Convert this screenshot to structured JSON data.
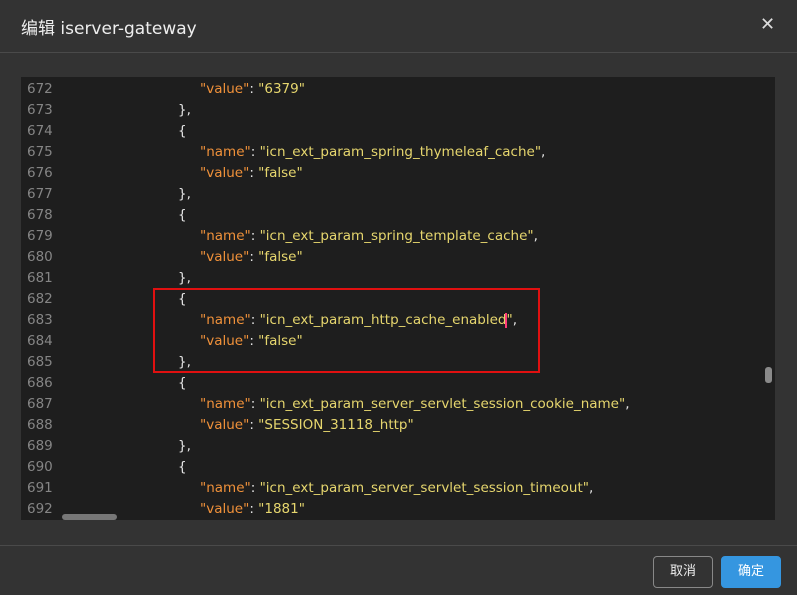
{
  "dialog": {
    "title": "编辑 iserver-gateway",
    "close_icon": "close-icon",
    "cancel_label": "取消",
    "ok_label": "确定"
  },
  "colors": {
    "key": "#f0913a",
    "string": "#e6d66e",
    "accent": "#3596e0",
    "highlight_box": "#e01010"
  },
  "editor": {
    "lines": [
      {
        "n": "672",
        "indent": 2,
        "key": "value",
        "val": "6379",
        "tail": ""
      },
      {
        "n": "673",
        "indent": 1,
        "text": "},"
      },
      {
        "n": "674",
        "indent": 1,
        "text": "{"
      },
      {
        "n": "675",
        "indent": 2,
        "key": "name",
        "val": "icn_ext_param_spring_thymeleaf_cache",
        "tail": ","
      },
      {
        "n": "676",
        "indent": 2,
        "key": "value",
        "val": "false",
        "tail": ""
      },
      {
        "n": "677",
        "indent": 1,
        "text": "},"
      },
      {
        "n": "678",
        "indent": 1,
        "text": "{"
      },
      {
        "n": "679",
        "indent": 2,
        "key": "name",
        "val": "icn_ext_param_spring_template_cache",
        "tail": ","
      },
      {
        "n": "680",
        "indent": 2,
        "key": "value",
        "val": "false",
        "tail": ""
      },
      {
        "n": "681",
        "indent": 1,
        "text": "},"
      },
      {
        "n": "682",
        "indent": 1,
        "text": "{"
      },
      {
        "n": "683",
        "indent": 2,
        "key": "name",
        "val": "icn_ext_param_http_cache_enabled",
        "tail": ",",
        "cursor": true
      },
      {
        "n": "684",
        "indent": 2,
        "key": "value",
        "val": "false",
        "tail": ""
      },
      {
        "n": "685",
        "indent": 1,
        "text": "},"
      },
      {
        "n": "686",
        "indent": 1,
        "text": "{"
      },
      {
        "n": "687",
        "indent": 2,
        "key": "name",
        "val": "icn_ext_param_server_servlet_session_cookie_name",
        "tail": ","
      },
      {
        "n": "688",
        "indent": 2,
        "key": "value",
        "val": "SESSION_31118_http",
        "tail": ""
      },
      {
        "n": "689",
        "indent": 1,
        "text": "},"
      },
      {
        "n": "690",
        "indent": 1,
        "text": "{"
      },
      {
        "n": "691",
        "indent": 2,
        "key": "name",
        "val": "icn_ext_param_server_servlet_session_timeout",
        "tail": ","
      },
      {
        "n": "692",
        "indent": 2,
        "key": "value",
        "val": "1881",
        "tail": ""
      }
    ]
  }
}
